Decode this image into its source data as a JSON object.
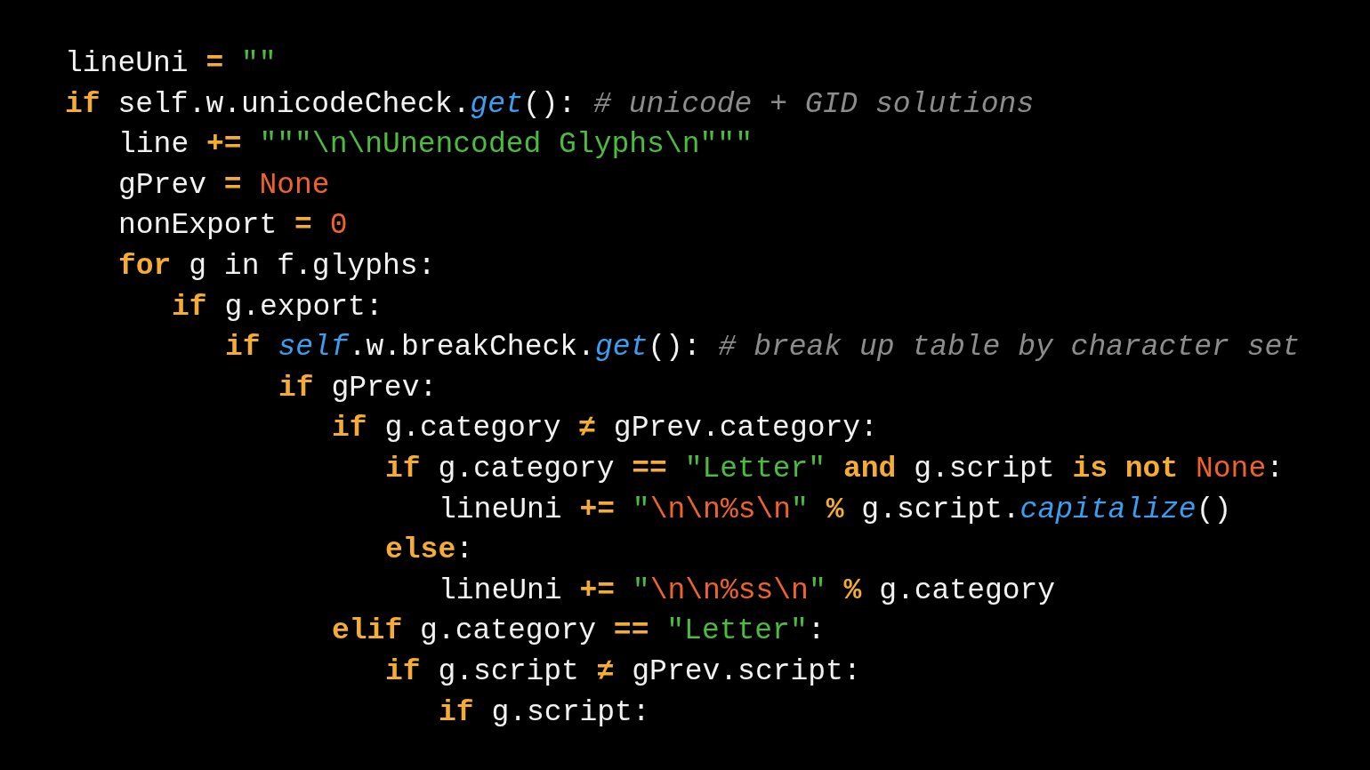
{
  "code": {
    "lines": [
      {
        "tokens": [
          {
            "kind": "text",
            "text": "lineUni "
          },
          {
            "kind": "op",
            "text": "= "
          },
          {
            "kind": "str",
            "text": "\"\""
          }
        ]
      },
      {
        "tokens": [
          {
            "kind": "kw",
            "text": "if"
          },
          {
            "kind": "text",
            "text": " self.w.unicodeCheck."
          },
          {
            "kind": "fn",
            "text": "get"
          },
          {
            "kind": "text",
            "text": "(): "
          },
          {
            "kind": "comment",
            "text": "# unicode + GID solutions"
          }
        ],
        "children": [
          {
            "tokens": [
              {
                "kind": "text",
                "text": "line "
              },
              {
                "kind": "op",
                "text": "+= "
              },
              {
                "kind": "str",
                "text": "\"\"\"\\n\\nUnencoded Glyphs\\n\"\"\""
              }
            ]
          },
          {
            "tokens": [
              {
                "kind": "text",
                "text": "gPrev "
              },
              {
                "kind": "op",
                "text": "= "
              },
              {
                "kind": "const",
                "text": "None"
              }
            ]
          },
          {
            "tokens": [
              {
                "kind": "text",
                "text": "nonExport "
              },
              {
                "kind": "op",
                "text": "= "
              },
              {
                "kind": "const",
                "text": "0"
              }
            ]
          },
          {
            "tokens": [
              {
                "kind": "kw",
                "text": "for"
              },
              {
                "kind": "text",
                "text": " g in f.glyphs:"
              }
            ],
            "children": [
              {
                "tokens": [
                  {
                    "kind": "kw",
                    "text": "if"
                  },
                  {
                    "kind": "text",
                    "text": " g.export:"
                  }
                ],
                "children": [
                  {
                    "tokens": [
                      {
                        "kind": "kw",
                        "text": "if "
                      },
                      {
                        "kind": "self",
                        "text": "self"
                      },
                      {
                        "kind": "text",
                        "text": ".w.breakCheck."
                      },
                      {
                        "kind": "fn",
                        "text": "get"
                      },
                      {
                        "kind": "text",
                        "text": "(): "
                      },
                      {
                        "kind": "comment",
                        "text": "# break up table by character set"
                      }
                    ],
                    "children": [
                      {
                        "tokens": [
                          {
                            "kind": "kw",
                            "text": "if"
                          },
                          {
                            "kind": "text",
                            "text": " gPrev:"
                          }
                        ],
                        "children": [
                          {
                            "tokens": [
                              {
                                "kind": "kw",
                                "text": "if"
                              },
                              {
                                "kind": "text",
                                "text": " g.category "
                              },
                              {
                                "kind": "op",
                                "text": "≠"
                              },
                              {
                                "kind": "text",
                                "text": " gPrev.category:"
                              }
                            ],
                            "children": [
                              {
                                "tokens": [
                                  {
                                    "kind": "kw",
                                    "text": "if"
                                  },
                                  {
                                    "kind": "text",
                                    "text": " g.category "
                                  },
                                  {
                                    "kind": "op",
                                    "text": "== "
                                  },
                                  {
                                    "kind": "str",
                                    "text": "\"Letter\" "
                                  },
                                  {
                                    "kind": "kw",
                                    "text": "and"
                                  },
                                  {
                                    "kind": "text",
                                    "text": " g.script "
                                  },
                                  {
                                    "kind": "kw",
                                    "text": "is not "
                                  },
                                  {
                                    "kind": "const",
                                    "text": "None"
                                  },
                                  {
                                    "kind": "text",
                                    "text": ":"
                                  }
                                ],
                                "children": [
                                  {
                                    "tokens": [
                                      {
                                        "kind": "text",
                                        "text": "lineUni "
                                      },
                                      {
                                        "kind": "op",
                                        "text": "+= "
                                      },
                                      {
                                        "kind": "str",
                                        "text": "\""
                                      },
                                      {
                                        "kind": "esc",
                                        "text": "\\n\\n%s\\n"
                                      },
                                      {
                                        "kind": "str",
                                        "text": "\" "
                                      },
                                      {
                                        "kind": "op",
                                        "text": "%"
                                      },
                                      {
                                        "kind": "text",
                                        "text": " g.script."
                                      },
                                      {
                                        "kind": "fn",
                                        "text": "capitalize"
                                      },
                                      {
                                        "kind": "text",
                                        "text": "()"
                                      }
                                    ]
                                  }
                                ]
                              },
                              {
                                "tokens": [
                                  {
                                    "kind": "kw",
                                    "text": "else"
                                  },
                                  {
                                    "kind": "text",
                                    "text": ":"
                                  }
                                ],
                                "children": [
                                  {
                                    "tokens": [
                                      {
                                        "kind": "text",
                                        "text": "lineUni "
                                      },
                                      {
                                        "kind": "op",
                                        "text": "+= "
                                      },
                                      {
                                        "kind": "str",
                                        "text": "\""
                                      },
                                      {
                                        "kind": "esc",
                                        "text": "\\n\\n%ss\\n"
                                      },
                                      {
                                        "kind": "str",
                                        "text": "\" "
                                      },
                                      {
                                        "kind": "op",
                                        "text": "%"
                                      },
                                      {
                                        "kind": "text",
                                        "text": " g.category"
                                      }
                                    ]
                                  }
                                ]
                              }
                            ]
                          },
                          {
                            "tokens": [
                              {
                                "kind": "kw",
                                "text": "elif"
                              },
                              {
                                "kind": "text",
                                "text": " g.category "
                              },
                              {
                                "kind": "op",
                                "text": "== "
                              },
                              {
                                "kind": "str",
                                "text": "\"Letter\""
                              },
                              {
                                "kind": "text",
                                "text": ":"
                              }
                            ],
                            "children": [
                              {
                                "tokens": [
                                  {
                                    "kind": "kw",
                                    "text": "if"
                                  },
                                  {
                                    "kind": "text",
                                    "text": " g.script "
                                  },
                                  {
                                    "kind": "op",
                                    "text": "≠"
                                  },
                                  {
                                    "kind": "text",
                                    "text": " gPrev.script:"
                                  }
                                ],
                                "children": [
                                  {
                                    "tokens": [
                                      {
                                        "kind": "kw",
                                        "text": "if"
                                      },
                                      {
                                        "kind": "text",
                                        "text": " g.script:"
                                      }
                                    ]
                                  }
                                ]
                              }
                            ]
                          }
                        ]
                      }
                    ]
                  }
                ]
              }
            ]
          }
        ]
      }
    ]
  }
}
